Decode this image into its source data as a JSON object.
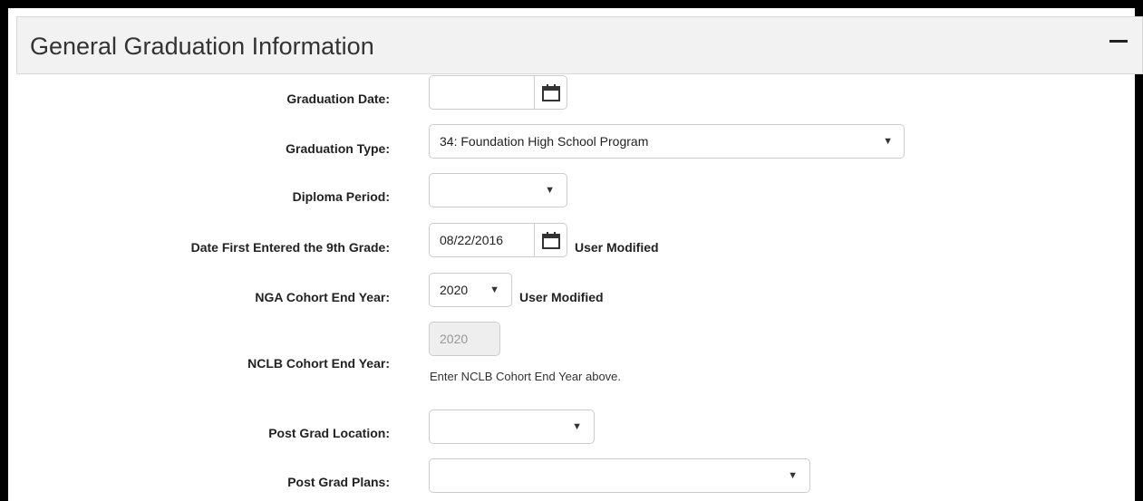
{
  "panel": {
    "title": "General Graduation Information",
    "collapse_symbol": "−"
  },
  "fields": {
    "graduation_date": {
      "label": "Graduation Date:",
      "value": ""
    },
    "graduation_type": {
      "label": "Graduation Type:",
      "value": "34: Foundation High School Program"
    },
    "diploma_period": {
      "label": "Diploma Period:",
      "value": ""
    },
    "date_first_9th": {
      "label": "Date First Entered the 9th Grade:",
      "value": "08/22/2016",
      "note": "User Modified"
    },
    "nga_cohort": {
      "label": "NGA Cohort End Year:",
      "value": "2020",
      "note": "User Modified"
    },
    "nclb_cohort": {
      "label": "NCLB Cohort End Year:",
      "value": "2020",
      "helper": "Enter NCLB Cohort End Year above."
    },
    "post_grad_location": {
      "label": "Post Grad Location:",
      "value": ""
    },
    "post_grad_plans": {
      "label": "Post Grad Plans:",
      "value": ""
    }
  },
  "icons": {
    "calendar": "calendar-icon",
    "dropdown": "caret-down-icon",
    "caret_char": "▼"
  }
}
